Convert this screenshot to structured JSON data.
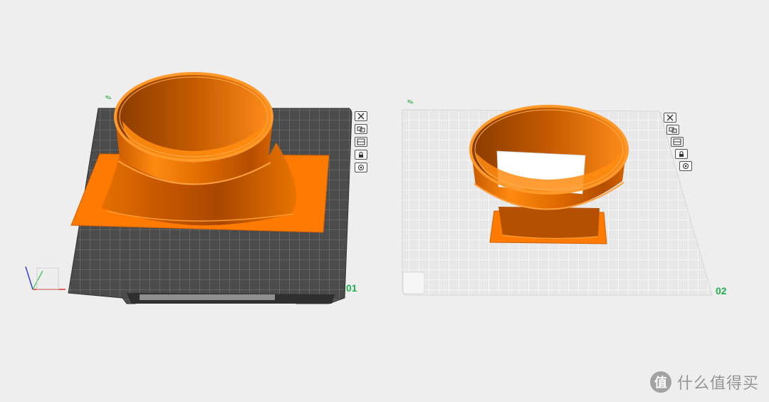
{
  "plates": [
    {
      "label": "01",
      "theme": "dark",
      "model": "round-to-square adapter, bell base"
    },
    {
      "label": "02",
      "theme": "light",
      "model": "round-to-square adapter, short base"
    }
  ],
  "plate_tools": [
    {
      "icon": "close-icon"
    },
    {
      "icon": "arrange-icon"
    },
    {
      "icon": "orient-icon"
    },
    {
      "icon": "lock-icon"
    },
    {
      "icon": "settings-icon"
    }
  ],
  "colors": {
    "background": "#eeeeee",
    "model_orange": "#ff7a00",
    "model_orange_dark": "#b34f00",
    "dark_plate": "#4a4a4a",
    "light_plate": "#e6e6e6",
    "label_green": "#20b050"
  },
  "watermark": {
    "logo": "值",
    "text": "什么值得买"
  }
}
